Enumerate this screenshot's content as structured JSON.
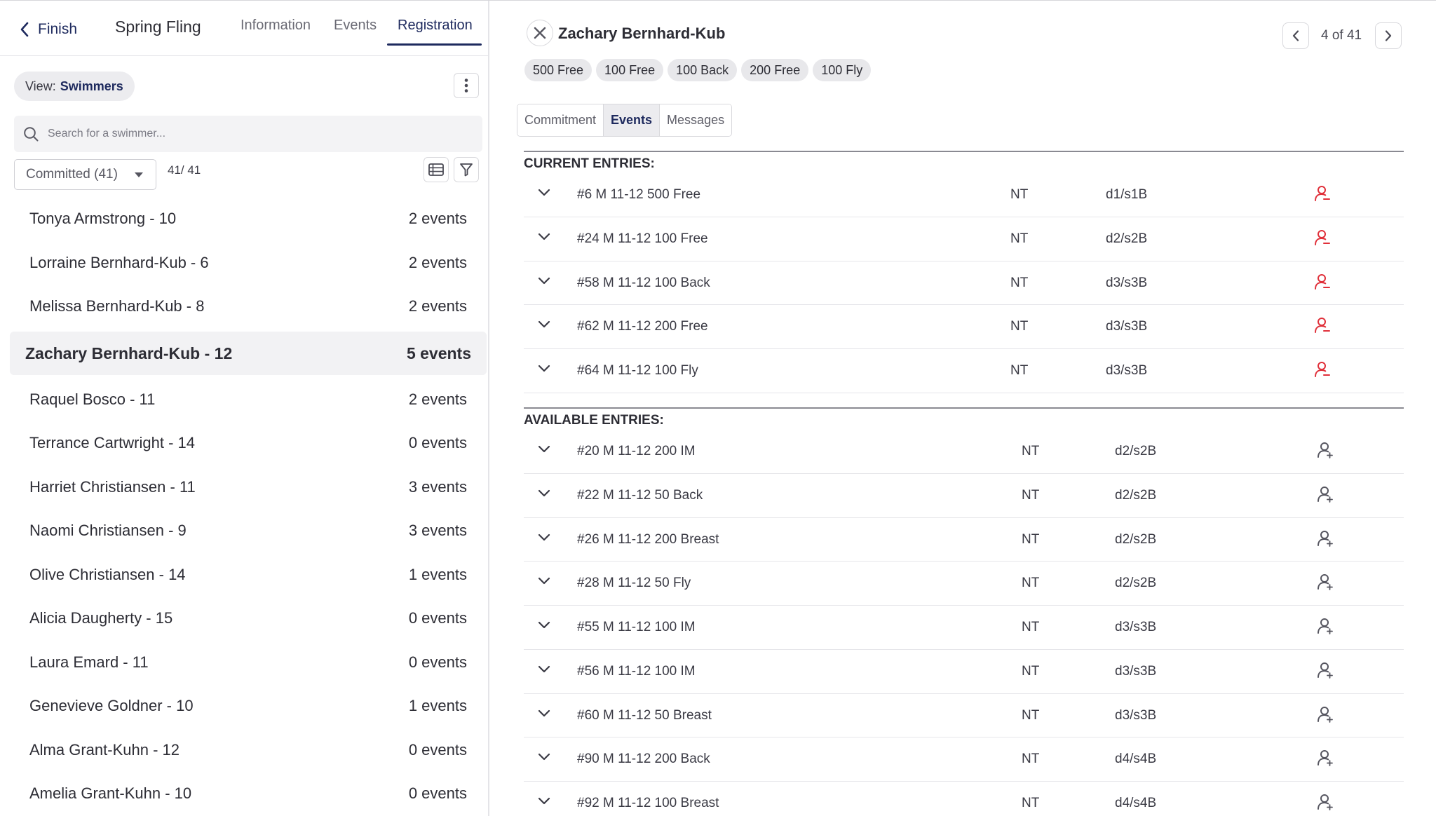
{
  "nav": {
    "back_label": "Finish",
    "meet_title": "Spring Fling",
    "tabs": [
      "Information",
      "Events",
      "Registration"
    ],
    "active_tab": "Registration"
  },
  "roster": {
    "view_prefix": "View:",
    "view_value": "Swimmers",
    "search_placeholder": "Search for a swimmer...",
    "filter_value": "Committed (41)",
    "count": "41/ 41",
    "swimmers": [
      {
        "name": "Tonya Armstrong - 10",
        "events": "2 events"
      },
      {
        "name": "Lorraine Bernhard-Kub - 6",
        "events": "2 events"
      },
      {
        "name": "Melissa Bernhard-Kub - 8",
        "events": "2 events"
      },
      {
        "name": "Zachary Bernhard-Kub - 12",
        "events": "5 events",
        "selected": true
      },
      {
        "name": "Raquel Bosco - 11",
        "events": "2 events"
      },
      {
        "name": "Terrance Cartwright - 14",
        "events": "0 events"
      },
      {
        "name": "Harriet Christiansen - 11",
        "events": "3 events"
      },
      {
        "name": "Naomi Christiansen - 9",
        "events": "3 events"
      },
      {
        "name": "Olive Christiansen - 14",
        "events": "1 events"
      },
      {
        "name": "Alicia Daugherty - 15",
        "events": "0 events"
      },
      {
        "name": "Laura Emard - 11",
        "events": "0 events"
      },
      {
        "name": "Genevieve Goldner - 10",
        "events": "1 events"
      },
      {
        "name": "Alma Grant-Kuhn - 12",
        "events": "0 events"
      },
      {
        "name": "Amelia Grant-Kuhn - 10",
        "events": "0 events"
      }
    ]
  },
  "detail": {
    "name": "Zachary Bernhard-Kub",
    "pager": "4 of 41",
    "event_chips": [
      "500 Free",
      "100 Free",
      "100 Back",
      "200 Free",
      "100 Fly"
    ],
    "tabs": [
      "Commitment",
      "Events",
      "Messages"
    ],
    "active_tab": "Events",
    "current_label": "CURRENT ENTRIES:",
    "available_label": "AVAILABLE ENTRIES:",
    "current_entries": [
      {
        "event": "#6 M 11-12 500 Free",
        "time": "NT",
        "heat": "d1/s1B"
      },
      {
        "event": "#24 M 11-12 100 Free",
        "time": "NT",
        "heat": "d2/s2B"
      },
      {
        "event": "#58 M 11-12 100 Back",
        "time": "NT",
        "heat": "d3/s3B"
      },
      {
        "event": "#62 M 11-12 200 Free",
        "time": "NT",
        "heat": "d3/s3B"
      },
      {
        "event": "#64 M 11-12 100 Fly",
        "time": "NT",
        "heat": "d3/s3B"
      }
    ],
    "available_entries": [
      {
        "event": "#20 M 11-12 200 IM",
        "time": "NT",
        "heat": "d2/s2B"
      },
      {
        "event": "#22 M 11-12 50 Back",
        "time": "NT",
        "heat": "d2/s2B"
      },
      {
        "event": "#26 M 11-12 200 Breast",
        "time": "NT",
        "heat": "d2/s2B"
      },
      {
        "event": "#28 M 11-12 50 Fly",
        "time": "NT",
        "heat": "d2/s2B"
      },
      {
        "event": "#55 M 11-12 100 IM",
        "time": "NT",
        "heat": "d3/s3B"
      },
      {
        "event": "#56 M 11-12 100 IM",
        "time": "NT",
        "heat": "d3/s3B"
      },
      {
        "event": "#60 M 11-12 50 Breast",
        "time": "NT",
        "heat": "d3/s3B"
      },
      {
        "event": "#90 M 11-12 200 Back",
        "time": "NT",
        "heat": "d4/s4B"
      },
      {
        "event": "#92 M 11-12 100 Breast",
        "time": "NT",
        "heat": "d4/s4B"
      }
    ]
  },
  "colors": {
    "accent": "#1e2a5e",
    "remove_icon": "#e0303a",
    "add_icon": "#55555f",
    "selected_row_bg": "#f2f2f4"
  },
  "icons": {
    "back": "chevron-left-icon",
    "more": "kebab-menu-icon",
    "search": "search-icon",
    "table_view": "table-view-icon",
    "filter": "filter-icon",
    "close": "close-icon",
    "prev": "chevron-left-icon",
    "next": "chevron-right-icon",
    "expand": "chevron-down-icon",
    "remove_entry": "user-minus-icon",
    "add_entry": "user-plus-icon"
  }
}
